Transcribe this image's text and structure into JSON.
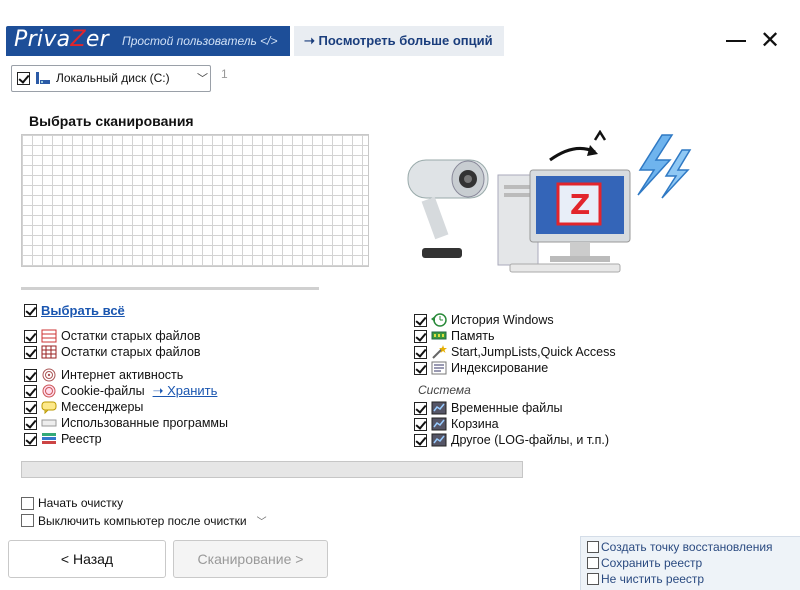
{
  "header": {
    "logo_pre": "Priva",
    "logo_z": "Z",
    "logo_post": "er",
    "mode_label": "Простой пользователь",
    "mode_icon": "code-brackets-icon",
    "more_options": "➝ Посмотреть больше опций"
  },
  "drive": {
    "label": "Локальный диск (C:)",
    "number": "1",
    "checked": true
  },
  "scan": {
    "title": "Выбрать сканирования"
  },
  "select_all": "Выбрать всё",
  "left_items": [
    {
      "label": "Остатки старых файлов",
      "icon": "red-table-icon"
    },
    {
      "label": "Остатки старых файлов",
      "icon": "grid-table-icon"
    },
    {
      "label": "Интернет активность",
      "icon": "fingerprint-icon"
    },
    {
      "label": "Cookie-файлы",
      "icon": "cookie-fingerprint-icon",
      "extra": "➝ Хранить"
    },
    {
      "label": "Мессенджеры",
      "icon": "chat-bubble-icon"
    },
    {
      "label": "Использованные программы",
      "icon": "program-bar-icon"
    },
    {
      "label": "Реестр",
      "icon": "registry-icon"
    }
  ],
  "right_items": [
    {
      "label": "История Windows",
      "icon": "history-clock-icon"
    },
    {
      "label": "Память",
      "icon": "memory-chip-icon"
    },
    {
      "label": "Start,JumpLists,Quick Access",
      "icon": "wand-icon"
    },
    {
      "label": "Индексирование",
      "icon": "index-list-icon"
    }
  ],
  "system": {
    "title": "Система",
    "items": [
      {
        "label": "Временные файлы",
        "icon": "temp-files-icon"
      },
      {
        "label": "Корзина",
        "icon": "recycle-bin-icon"
      },
      {
        "label": "Другое (LOG-файлы, и т.п.)",
        "icon": "log-files-icon"
      }
    ]
  },
  "options": {
    "start_cleaning": "Начать очистку",
    "shutdown_after": "Выключить компьютер после очистки"
  },
  "buttons": {
    "back": "< Назад",
    "scan": "Сканирование >"
  },
  "bottom_options": [
    "Создать точку восстановления",
    "Сохранить реестр",
    "Не чистить реестр"
  ],
  "colors": {
    "brand_blue": "#1d4e98",
    "link_blue": "#1a56b0",
    "logo_red": "#e2252c"
  }
}
